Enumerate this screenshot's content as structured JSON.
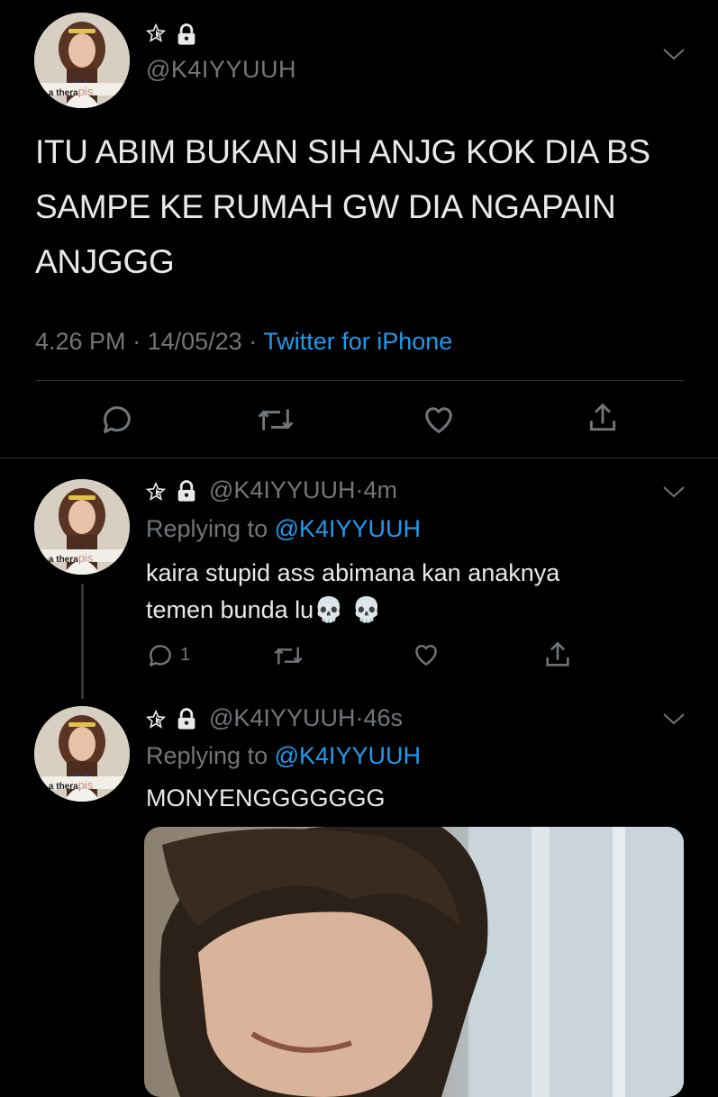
{
  "main_tweet": {
    "handle": "@K4IYYUUH",
    "name_icons": [
      "star-outline-icon",
      "lock-icon"
    ],
    "text": "ITU ABIM BUKAN SIH ANJG KOK DIA BS SAMPE KE RUMAH GW DIA NGAPAIN ANJGGG",
    "time": "4.26 PM",
    "separator": "·",
    "date": "14/05/23",
    "source": "Twitter for iPhone",
    "actions": [
      "reply-icon",
      "retweet-icon",
      "like-icon",
      "share-icon"
    ],
    "avatar_caption": "ee a thera",
    "avatar_caption_tail": "pis"
  },
  "replies": [
    {
      "handle": "@K4IYYUUH",
      "dot": "·",
      "time": "4m",
      "replying_prefix": "Replying to",
      "replying_handle": "@K4IYYUUH",
      "text_line1": "kaira stupid ass abimana kan anaknya",
      "text_line2": "temen bunda lu",
      "emoji": "💀 💀",
      "reply_count": "1",
      "avatar_caption": "ee a thera",
      "avatar_caption_tail": "pis"
    },
    {
      "handle": "@K4IYYUUH",
      "dot": "·",
      "time": "46s",
      "replying_prefix": "Replying to",
      "replying_handle": "@K4IYYUUH",
      "text": "MONYENGGGGGGG",
      "avatar_caption": "ee a thera",
      "avatar_caption_tail": "pis"
    }
  ],
  "colors": {
    "background": "#000000",
    "accent": "#1d9bf0",
    "muted": "#71767b",
    "text": "#e7e9ea"
  }
}
